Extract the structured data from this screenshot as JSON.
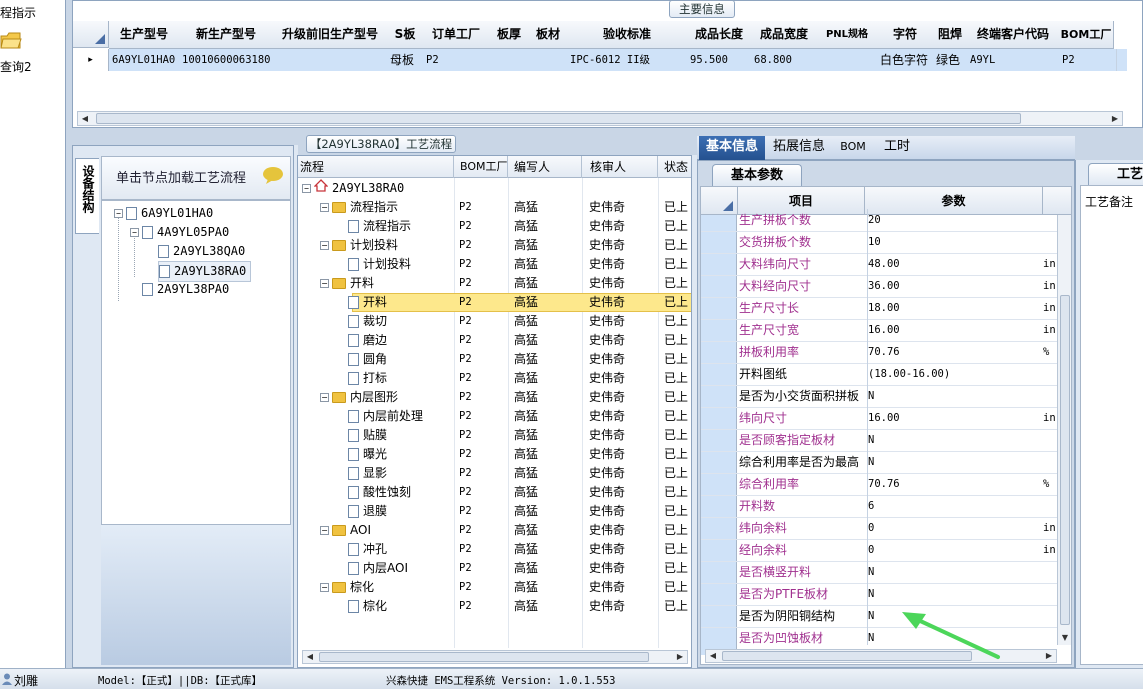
{
  "left_nav": {
    "item1": "程指示",
    "item2": "查询2"
  },
  "main_info": {
    "title": "主要信息",
    "columns": [
      "生产型号",
      "新生产型号",
      "升级前旧生产型号",
      "S板",
      "订单工厂",
      "板厚",
      "板材",
      "验收标准",
      "成品长度",
      "成品宽度",
      "PNL规格",
      "字符",
      "阻焊",
      "终端客户代码",
      "BOM工厂"
    ],
    "row": [
      "6A9YL01HA0",
      "10010600063180",
      "",
      "母板",
      "P2",
      "",
      "",
      "IPC-6012 II级",
      "95.500",
      "68.800",
      "",
      "白色字符",
      "绿色",
      "A9YL",
      "P2"
    ],
    "row_marker": "▸"
  },
  "equipment_tab": "设备结构",
  "node_panel": {
    "hint": "单击节点加载工艺流程",
    "tree": [
      {
        "label": "6A9YL01HA0",
        "level": 0,
        "toggle": "-"
      },
      {
        "label": "4A9YL05PA0",
        "level": 1,
        "toggle": "-"
      },
      {
        "label": "2A9YL38QA0",
        "level": 2,
        "toggle": ""
      },
      {
        "label": "2A9YL38RA0",
        "level": 2,
        "toggle": "",
        "selected": true
      },
      {
        "label": "2A9YL38PA0",
        "level": 1,
        "toggle": ""
      }
    ]
  },
  "process_panel": {
    "title": "【2A9YL38RA0】工艺流程",
    "columns": [
      "流程",
      "BOM工厂",
      "编写人",
      "核审人",
      "状态"
    ],
    "root": "2A9YL38RA0",
    "rows": [
      {
        "label": "流程指示",
        "type": "folder",
        "level": 1,
        "bom": "P2",
        "writer": "高猛",
        "reviewer": "史伟奇",
        "status": "已上"
      },
      {
        "label": "流程指示",
        "type": "doc",
        "level": 2,
        "bom": "P2",
        "writer": "高猛",
        "reviewer": "史伟奇",
        "status": "已上"
      },
      {
        "label": "计划投料",
        "type": "folder",
        "level": 1,
        "bom": "P2",
        "writer": "高猛",
        "reviewer": "史伟奇",
        "status": "已上"
      },
      {
        "label": "计划投料",
        "type": "doc",
        "level": 2,
        "bom": "P2",
        "writer": "高猛",
        "reviewer": "史伟奇",
        "status": "已上"
      },
      {
        "label": "开料",
        "type": "folder",
        "level": 1,
        "bom": "P2",
        "writer": "高猛",
        "reviewer": "史伟奇",
        "status": "已上"
      },
      {
        "label": "开料",
        "type": "doc",
        "level": 2,
        "bom": "P2",
        "writer": "高猛",
        "reviewer": "史伟奇",
        "status": "已上",
        "selected": true
      },
      {
        "label": "裁切",
        "type": "doc",
        "level": 2,
        "bom": "P2",
        "writer": "高猛",
        "reviewer": "史伟奇",
        "status": "已上"
      },
      {
        "label": "磨边",
        "type": "doc",
        "level": 2,
        "bom": "P2",
        "writer": "高猛",
        "reviewer": "史伟奇",
        "status": "已上"
      },
      {
        "label": "圆角",
        "type": "doc",
        "level": 2,
        "bom": "P2",
        "writer": "高猛",
        "reviewer": "史伟奇",
        "status": "已上"
      },
      {
        "label": "打标",
        "type": "doc",
        "level": 2,
        "bom": "P2",
        "writer": "高猛",
        "reviewer": "史伟奇",
        "status": "已上"
      },
      {
        "label": "内层图形",
        "type": "folder",
        "level": 1,
        "bom": "P2",
        "writer": "高猛",
        "reviewer": "史伟奇",
        "status": "已上"
      },
      {
        "label": "内层前处理",
        "type": "doc",
        "level": 2,
        "bom": "P2",
        "writer": "高猛",
        "reviewer": "史伟奇",
        "status": "已上"
      },
      {
        "label": "贴膜",
        "type": "doc",
        "level": 2,
        "bom": "P2",
        "writer": "高猛",
        "reviewer": "史伟奇",
        "status": "已上"
      },
      {
        "label": "曝光",
        "type": "doc",
        "level": 2,
        "bom": "P2",
        "writer": "高猛",
        "reviewer": "史伟奇",
        "status": "已上"
      },
      {
        "label": "显影",
        "type": "doc",
        "level": 2,
        "bom": "P2",
        "writer": "高猛",
        "reviewer": "史伟奇",
        "status": "已上"
      },
      {
        "label": "酸性蚀刻",
        "type": "doc",
        "level": 2,
        "bom": "P2",
        "writer": "高猛",
        "reviewer": "史伟奇",
        "status": "已上"
      },
      {
        "label": "退膜",
        "type": "doc",
        "level": 2,
        "bom": "P2",
        "writer": "高猛",
        "reviewer": "史伟奇",
        "status": "已上"
      },
      {
        "label": "AOI",
        "type": "folder",
        "level": 1,
        "bom": "P2",
        "writer": "高猛",
        "reviewer": "史伟奇",
        "status": "已上"
      },
      {
        "label": "冲孔",
        "type": "doc",
        "level": 2,
        "bom": "P2",
        "writer": "高猛",
        "reviewer": "史伟奇",
        "status": "已上"
      },
      {
        "label": "内层AOI",
        "type": "doc",
        "level": 2,
        "bom": "P2",
        "writer": "高猛",
        "reviewer": "史伟奇",
        "status": "已上"
      },
      {
        "label": "棕化",
        "type": "folder",
        "level": 1,
        "bom": "P2",
        "writer": "高猛",
        "reviewer": "史伟奇",
        "status": "已上"
      },
      {
        "label": "棕化",
        "type": "doc",
        "level": 2,
        "bom": "P2",
        "writer": "高猛",
        "reviewer": "史伟奇",
        "status": "已上"
      }
    ]
  },
  "info_tabs": [
    "基本信息",
    "拓展信息",
    "BOM",
    "工时"
  ],
  "params_panel": {
    "subtab": "基本参数",
    "col_item": "项目",
    "col_param": "参数",
    "rows": [
      {
        "label": "生产拼板个数",
        "value": "20",
        "unit": "",
        "color": "#a0308f"
      },
      {
        "label": "交货拼板个数",
        "value": "10",
        "unit": "",
        "color": "#a0308f"
      },
      {
        "label": "大料纬向尺寸",
        "value": "48.00",
        "unit": "in",
        "color": "#a0308f"
      },
      {
        "label": "大料经向尺寸",
        "value": "36.00",
        "unit": "in",
        "color": "#a0308f"
      },
      {
        "label": "生产尺寸长",
        "value": "18.00",
        "unit": "in",
        "color": "#a0308f"
      },
      {
        "label": "生产尺寸宽",
        "value": "16.00",
        "unit": "in",
        "color": "#a0308f"
      },
      {
        "label": "拼板利用率",
        "value": "70.76",
        "unit": "%",
        "color": "#a0308f"
      },
      {
        "label": "开料图纸",
        "value": "(18.00-16.00)",
        "unit": "",
        "color": "#000000"
      },
      {
        "label": "是否为小交货面积拼板",
        "value": "N",
        "unit": "",
        "color": "#000000"
      },
      {
        "label": "纬向尺寸",
        "value": "16.00",
        "unit": "in",
        "color": "#a0308f"
      },
      {
        "label": "是否顾客指定板材",
        "value": "N",
        "unit": "",
        "color": "#a0308f"
      },
      {
        "label": "综合利用率是否为最高",
        "value": "N",
        "unit": "",
        "color": "#000000"
      },
      {
        "label": "综合利用率",
        "value": "70.76",
        "unit": "%",
        "color": "#a0308f"
      },
      {
        "label": "开料数",
        "value": "6",
        "unit": "",
        "color": "#a0308f"
      },
      {
        "label": "纬向余料",
        "value": "0",
        "unit": "in",
        "color": "#a0308f"
      },
      {
        "label": "经向余料",
        "value": "0",
        "unit": "in",
        "color": "#a0308f"
      },
      {
        "label": "是否横竖开料",
        "value": "N",
        "unit": "",
        "color": "#a0308f"
      },
      {
        "label": "是否为PTFE板材",
        "value": "N",
        "unit": "",
        "color": "#a0308f"
      },
      {
        "label": "是否为阴阳铜结构",
        "value": "N",
        "unit": "",
        "color": "#000000"
      },
      {
        "label": "是否为凹蚀板材",
        "value": "N",
        "unit": "",
        "color": "#a0308f"
      }
    ]
  },
  "side_panel": {
    "title": "工艺",
    "subtitle": "工艺备注"
  },
  "status_bar": {
    "left": "刘雕",
    "model": "Model:【正式】||DB:【正式库】",
    "system": "兴森快捷 EMS工程系统 Version: 1.0.1.553"
  },
  "colors": {
    "selected_row": "#fde88c",
    "header_blue": "#cfe2f8",
    "tab_active": "#2d5a96",
    "arrow": "#4cd65a"
  }
}
